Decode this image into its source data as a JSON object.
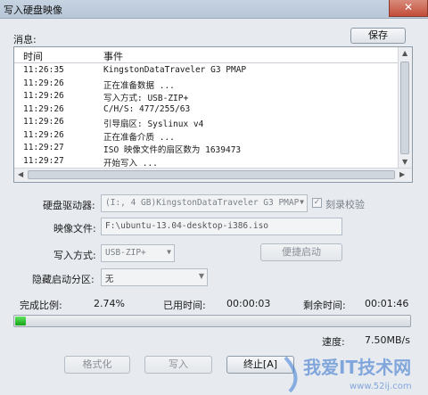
{
  "window": {
    "title": "写入硬盘映像",
    "close_label": "✕"
  },
  "messages": {
    "label": "消息:",
    "save_button": "保存"
  },
  "log": {
    "columns": [
      "时间",
      "事件"
    ],
    "rows": [
      {
        "time": "11:26:35",
        "event": "KingstonDataTraveler G3 PMAP"
      },
      {
        "time": "11:29:26",
        "event": "正在准备数据 ..."
      },
      {
        "time": "11:29:26",
        "event": "写入方式: USB-ZIP+"
      },
      {
        "time": "11:29:26",
        "event": "C/H/S: 477/255/63"
      },
      {
        "time": "11:29:26",
        "event": "引导扇区: Syslinux v4"
      },
      {
        "time": "11:29:26",
        "event": "正在准备介质 ..."
      },
      {
        "time": "11:29:27",
        "event": "ISO 映像文件的扇区数为 1639473"
      },
      {
        "time": "11:29:27",
        "event": "开始写入 ..."
      }
    ]
  },
  "form": {
    "drive_label": "硬盘驱动器:",
    "drive_value": "(I:, 4 GB)KingstonDataTraveler G3 PMAP",
    "verify_label": "刻录校验",
    "image_label": "映像文件:",
    "image_value": "F:\\ubuntu-13.04-desktop-i386.iso",
    "method_label": "写入方式:",
    "method_value": "USB-ZIP+",
    "boot_button": "便捷启动",
    "hidden_label": "隐藏启动分区:",
    "hidden_value": "无"
  },
  "status": {
    "complete_label": "完成比例:",
    "complete_value": "2.74%",
    "progress_fraction": 0.0274,
    "elapsed_label": "已用时间:",
    "elapsed_value": "00:00:03",
    "remaining_label": "剩余时间:",
    "remaining_value": "00:01:46",
    "speed_label": "速度:",
    "speed_value": "7.50MB/s"
  },
  "buttons": {
    "format": "格式化",
    "write": "写入",
    "abort": "终止[A]"
  },
  "watermark": {
    "text": "我爱IT技术网",
    "url": "www.52ij.com"
  },
  "colors": {
    "progress": "#22b322",
    "close": "#c24d38"
  }
}
